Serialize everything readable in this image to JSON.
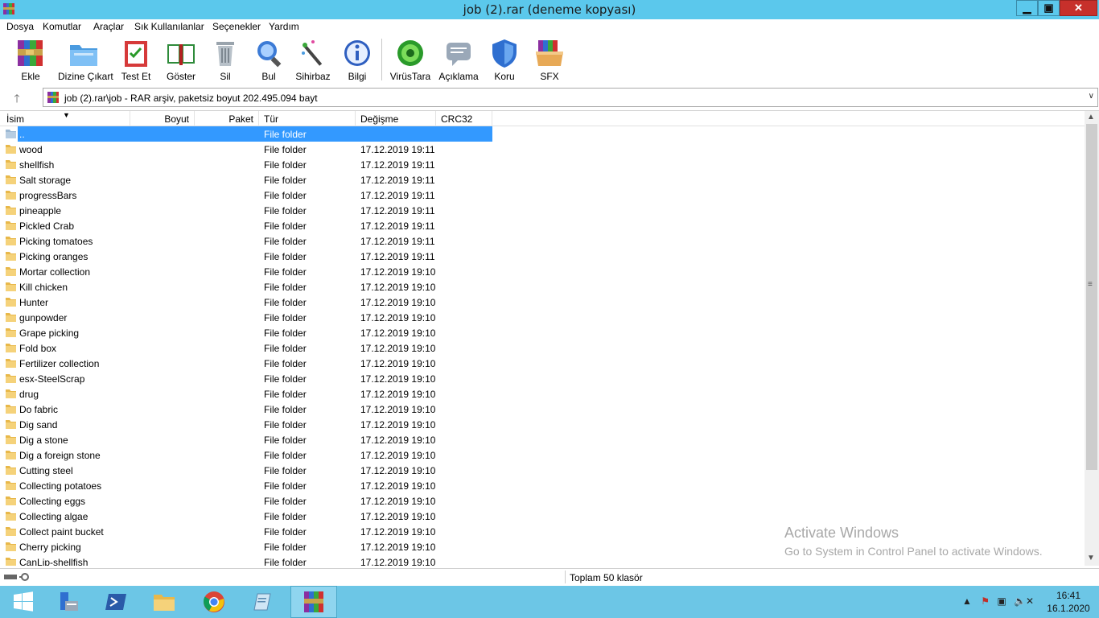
{
  "window": {
    "title": "job (2).rar (deneme kopyası)",
    "minimize": "▁",
    "maximize": "▣",
    "close": "✕"
  },
  "menu": [
    "Dosya",
    "Komutlar",
    "Araçlar",
    "Sık Kullanılanlar",
    "Seçenekler",
    "Yardım"
  ],
  "toolbar": {
    "add": "Ekle",
    "extract": "Dizine Çıkart",
    "test": "Test Et",
    "view": "Göster",
    "delete": "Sil",
    "find": "Bul",
    "wizard": "Sihirbaz",
    "info": "Bilgi",
    "virusscan": "VirüsTara",
    "comment": "Açıklama",
    "protect": "Koru",
    "sfx": "SFX"
  },
  "address": {
    "up": "🡑",
    "path": "job (2).rar\\job - RAR arşiv, paketsiz boyut 202.495.094 bayt"
  },
  "columns": {
    "name": "İsim",
    "size": "Boyut",
    "packed": "Paket",
    "type": "Tür",
    "modified": "Değişme",
    "crc": "CRC32"
  },
  "rows": [
    {
      "name": "..",
      "type": "File folder",
      "date": ""
    },
    {
      "name": "wood",
      "type": "File folder",
      "date": "17.12.2019 19:11"
    },
    {
      "name": "shellfish",
      "type": "File folder",
      "date": "17.12.2019 19:11"
    },
    {
      "name": "Salt storage",
      "type": "File folder",
      "date": "17.12.2019 19:11"
    },
    {
      "name": "progressBars",
      "type": "File folder",
      "date": "17.12.2019 19:11"
    },
    {
      "name": "pineapple",
      "type": "File folder",
      "date": "17.12.2019 19:11"
    },
    {
      "name": "Pickled Crab",
      "type": "File folder",
      "date": "17.12.2019 19:11"
    },
    {
      "name": "Picking tomatoes",
      "type": "File folder",
      "date": "17.12.2019 19:11"
    },
    {
      "name": "Picking oranges",
      "type": "File folder",
      "date": "17.12.2019 19:11"
    },
    {
      "name": "Mortar collection",
      "type": "File folder",
      "date": "17.12.2019 19:10"
    },
    {
      "name": "Kill chicken",
      "type": "File folder",
      "date": "17.12.2019 19:10"
    },
    {
      "name": "Hunter",
      "type": "File folder",
      "date": "17.12.2019 19:10"
    },
    {
      "name": "gunpowder",
      "type": "File folder",
      "date": "17.12.2019 19:10"
    },
    {
      "name": "Grape picking",
      "type": "File folder",
      "date": "17.12.2019 19:10"
    },
    {
      "name": "Fold box",
      "type": "File folder",
      "date": "17.12.2019 19:10"
    },
    {
      "name": "Fertilizer collection",
      "type": "File folder",
      "date": "17.12.2019 19:10"
    },
    {
      "name": "esx-SteelScrap",
      "type": "File folder",
      "date": "17.12.2019 19:10"
    },
    {
      "name": "drug",
      "type": "File folder",
      "date": "17.12.2019 19:10"
    },
    {
      "name": "Do fabric",
      "type": "File folder",
      "date": "17.12.2019 19:10"
    },
    {
      "name": "Dig sand",
      "type": "File folder",
      "date": "17.12.2019 19:10"
    },
    {
      "name": "Dig a stone",
      "type": "File folder",
      "date": "17.12.2019 19:10"
    },
    {
      "name": "Dig a foreign stone",
      "type": "File folder",
      "date": "17.12.2019 19:10"
    },
    {
      "name": "Cutting steel",
      "type": "File folder",
      "date": "17.12.2019 19:10"
    },
    {
      "name": "Collecting potatoes",
      "type": "File folder",
      "date": "17.12.2019 19:10"
    },
    {
      "name": "Collecting eggs",
      "type": "File folder",
      "date": "17.12.2019 19:10"
    },
    {
      "name": "Collecting algae",
      "type": "File folder",
      "date": "17.12.2019 19:10"
    },
    {
      "name": "Collect paint bucket",
      "type": "File folder",
      "date": "17.12.2019 19:10"
    },
    {
      "name": "Cherry picking",
      "type": "File folder",
      "date": "17.12.2019 19:10"
    },
    {
      "name": "CanLip-shellfish",
      "type": "File folder",
      "date": "17.12.2019 19:10"
    }
  ],
  "watermark": {
    "line1": "Activate Windows",
    "line2": "Go to System in Control Panel to activate Windows."
  },
  "status": {
    "total": "Toplam 50 klasör"
  },
  "taskbar": {
    "time": "16:41",
    "date": "16.1.2020"
  },
  "colors": {
    "titlebar": "#5bc8ec",
    "selection": "#3399ff",
    "taskbar": "#6cc6e6",
    "folder": "#e8b84a"
  }
}
